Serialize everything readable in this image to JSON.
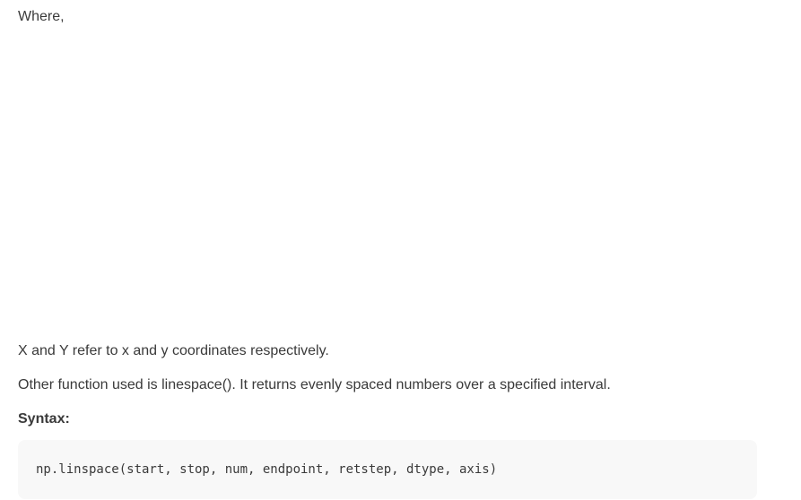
{
  "content": {
    "where_label": "Where,",
    "paragraph_xy": "X and Y refer to x and y coordinates respectively.",
    "paragraph_linespace": "Other function used is linespace(). It returns evenly spaced numbers over a specified interval.",
    "syntax_heading": "Syntax:",
    "code_snippet": "np.linspace(start, stop, num, endpoint, retstep, dtype, axis)"
  },
  "colors": {
    "text": "#3a3a3a",
    "code_background": "#f8f8f8",
    "page_background": "#ffffff"
  }
}
